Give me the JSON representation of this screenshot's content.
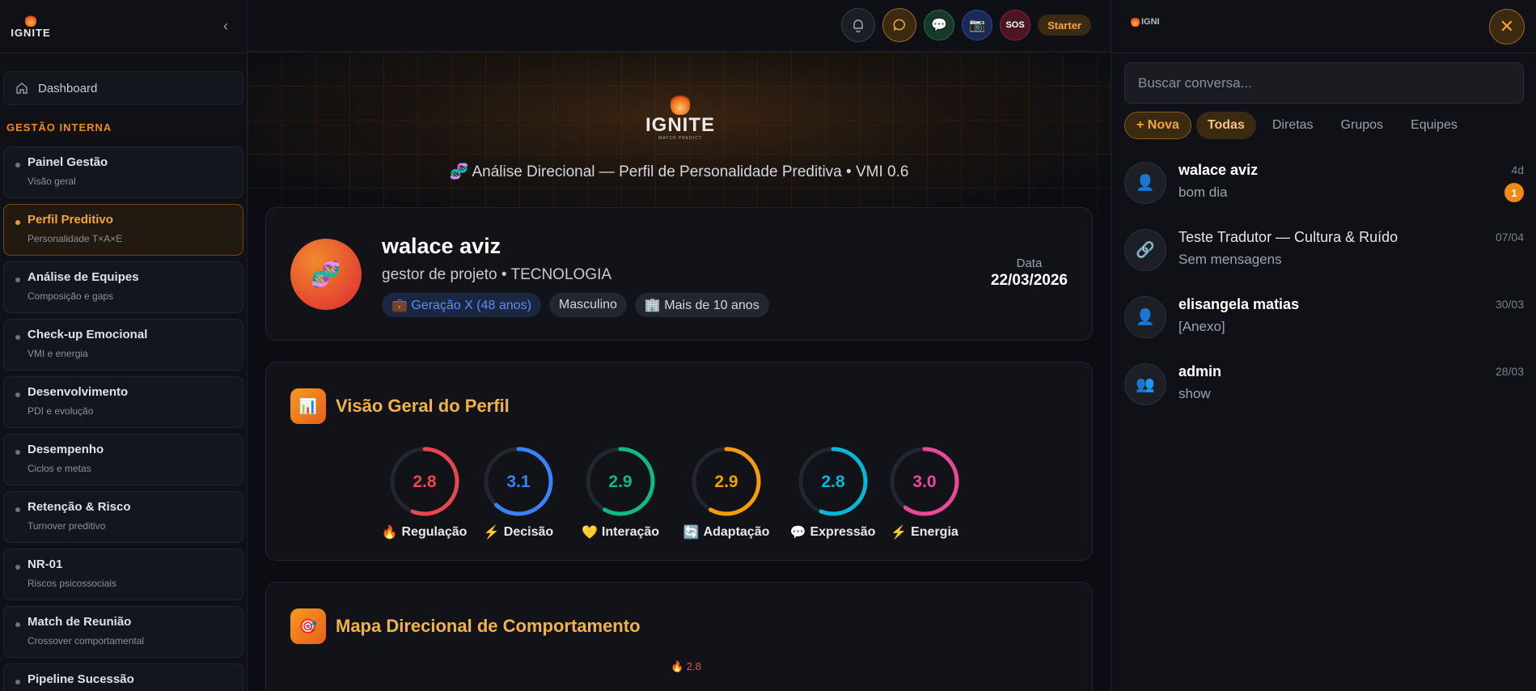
{
  "sidebar": {
    "logo_text": "IGNITE",
    "dashboard_label": "Dashboard",
    "section_label": "GESTÃO INTERNA",
    "items": [
      {
        "title": "Painel Gestão",
        "subtitle": "Visão geral"
      },
      {
        "title": "Perfil Preditivo",
        "subtitle": "Personalidade T×A×E"
      },
      {
        "title": "Análise de Equipes",
        "subtitle": "Composição e gaps"
      },
      {
        "title": "Check-up Emocional",
        "subtitle": "VMI e energia"
      },
      {
        "title": "Desenvolvimento",
        "subtitle": "PDI e evolução"
      },
      {
        "title": "Desempenho",
        "subtitle": "Ciclos e metas"
      },
      {
        "title": "Retenção & Risco",
        "subtitle": "Turnover preditivo"
      },
      {
        "title": "NR-01",
        "subtitle": "Riscos psicossociais"
      },
      {
        "title": "Match de Reunião",
        "subtitle": "Crossover comportamental"
      },
      {
        "title": "Pipeline Sucessão",
        "subtitle": ""
      }
    ]
  },
  "topbar": {
    "red_label": "SOS",
    "plan_label": "Starter"
  },
  "hero": {
    "logo_word": "IGNITE",
    "logo_sub": "MATCH PREDICT",
    "subtitle": "🧬 Análise Direcional — Perfil de Personalidade Preditiva • VMI 0.6"
  },
  "profile": {
    "name": "walace aviz",
    "role": "gestor de projeto • TECNOLOGIA",
    "avatar_emoji": "🧬",
    "tags": [
      "💼 Geração X (48 anos)",
      "Masculino",
      "🏢 Mais de 10 anos"
    ],
    "date_label": "Data",
    "date_value": "22/03/2026"
  },
  "overview": {
    "icon": "📊",
    "title": "Visão Geral do Perfil",
    "scale_max": 5,
    "gauges": [
      {
        "value": "2.8",
        "label": "Regulação",
        "emoji": "🔥",
        "color": "#e5484d"
      },
      {
        "value": "3.1",
        "label": "Decisão",
        "emoji": "⚡",
        "color": "#3b82f6"
      },
      {
        "value": "2.9",
        "label": "Interação",
        "emoji": "💛",
        "color": "#10b981"
      },
      {
        "value": "2.9",
        "label": "Adaptação",
        "emoji": "🔄",
        "color": "#f59e0b"
      },
      {
        "value": "2.8",
        "label": "Expressão",
        "emoji": "💬",
        "color": "#06b6d4"
      },
      {
        "value": "3.0",
        "label": "Energia",
        "emoji": "⚡",
        "color": "#ec4899"
      }
    ]
  },
  "map": {
    "icon": "🎯",
    "title": "Mapa Direcional de Comportamento",
    "peek": "🔥 2.8"
  },
  "chat": {
    "logo_text": "IGNI",
    "search_placeholder": "Buscar conversa...",
    "tabs": [
      "+ Nova",
      "Todas",
      "Diretas",
      "Grupos",
      "Equipes"
    ],
    "conversations": [
      {
        "name": "walace aviz",
        "message": "bom dia",
        "time": "4d",
        "badge": "1",
        "icon": "👤"
      },
      {
        "name": "Teste Tradutor — Cultura & Ruído",
        "message": "Sem mensagens",
        "time": "07/04",
        "icon": "🔗"
      },
      {
        "name": "elisangela matias",
        "message": "[Anexo]",
        "time": "30/03",
        "icon": "👤"
      },
      {
        "name": "admin",
        "message": "show",
        "time": "28/03",
        "icon": "👥"
      }
    ]
  }
}
